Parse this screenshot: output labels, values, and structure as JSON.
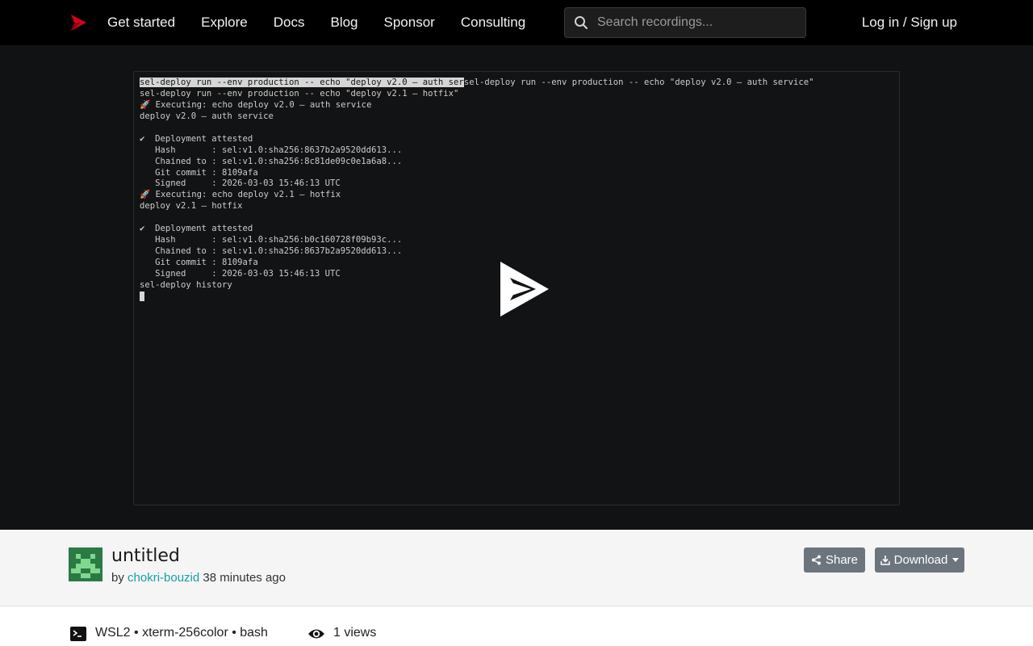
{
  "nav": {
    "links": [
      "Get started",
      "Explore",
      "Docs",
      "Blog",
      "Sponsor",
      "Consulting"
    ],
    "search_placeholder": "Search recordings...",
    "login_label": "Log in / Sign up"
  },
  "terminal": {
    "lines": [
      {
        "selected": "sel-deploy run --env production -- echo \"deploy v2.0 – auth ser",
        "rest": "sel-deploy run --env production -- echo \"deploy v2.0 – auth service\""
      },
      {
        "selected": "",
        "rest": "sel-deploy run --env production -- echo \"deploy v2.1 – hotfix\""
      },
      {
        "selected": "",
        "rest": "🚀 Executing: echo deploy v2.0 – auth service"
      },
      {
        "selected": "",
        "rest": "deploy v2.0 – auth service"
      },
      {
        "selected": "",
        "rest": ""
      },
      {
        "selected": "",
        "rest": "✔  Deployment attested"
      },
      {
        "selected": "",
        "rest": "   Hash       : sel:v1.0:sha256:8637b2a9520dd613..."
      },
      {
        "selected": "",
        "rest": "   Chained to : sel:v1.0:sha256:8c81de09c0e1a6a8..."
      },
      {
        "selected": "",
        "rest": "   Git commit : 8109afa"
      },
      {
        "selected": "",
        "rest": "   Signed     : 2026-03-03 15:46:13 UTC"
      },
      {
        "selected": "",
        "rest": "🚀 Executing: echo deploy v2.1 – hotfix"
      },
      {
        "selected": "",
        "rest": "deploy v2.1 – hotfix"
      },
      {
        "selected": "",
        "rest": ""
      },
      {
        "selected": "",
        "rest": "✔  Deployment attested"
      },
      {
        "selected": "",
        "rest": "   Hash       : sel:v1.0:sha256:b0c160728f09b93c..."
      },
      {
        "selected": "",
        "rest": "   Chained to : sel:v1.0:sha256:8637b2a9520dd613..."
      },
      {
        "selected": "",
        "rest": "   Git commit : 8109afa"
      },
      {
        "selected": "",
        "rest": "   Signed     : 2026-03-03 15:46:13 UTC"
      },
      {
        "selected": "",
        "rest": "sel-deploy history"
      }
    ]
  },
  "recording": {
    "title": "untitled",
    "by_prefix": "by",
    "author": "chokri-bouzid",
    "time_ago": "38 minutes ago",
    "share_label": "Share",
    "download_label": "Download",
    "env": "WSL2 • xterm-256color • bash",
    "views": "1 views"
  },
  "colors": {
    "accent_red": "#d0021b",
    "author_link": "#15a0a8",
    "button_gray": "#6c757d",
    "avatar_green": "#2b7a44",
    "avatar_light": "#7fd88f"
  },
  "icons": {
    "logo": "asciinema-logo",
    "search": "search-icon",
    "play": "play-icon",
    "share": "share-icon",
    "download": "download-icon",
    "terminal": "terminal-icon",
    "eye": "eye-icon"
  }
}
